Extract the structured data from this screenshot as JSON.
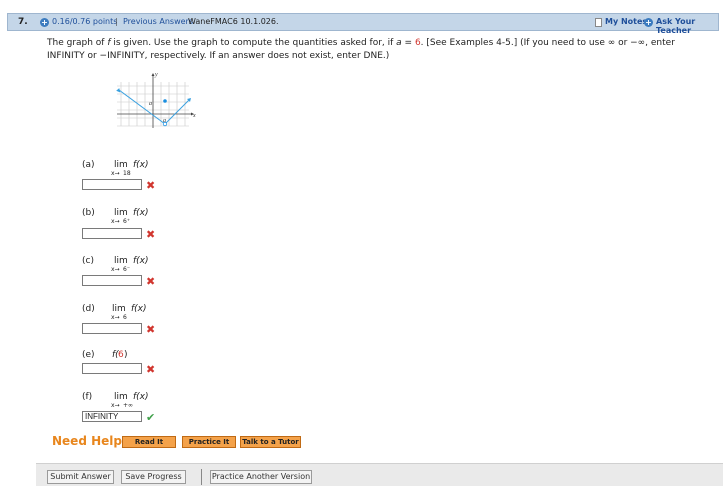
{
  "header": {
    "number": "7.",
    "points": "0.16/0.76 points",
    "separator": "|",
    "previous_answers": "Previous Answers",
    "problem_id": "WaneFMAC6 10.1.026.",
    "my_notes": "My Notes",
    "ask_teacher": "Ask Your Teacher"
  },
  "prompt": {
    "part1": "The graph of ",
    "f": "f",
    "part2": " is given. Use the graph to compute the quantities asked for, if ",
    "a": "a",
    "eq": " = ",
    "aval": "6",
    "part3": ". [See Examples 4-5.] (If you need to use ∞ or −∞, enter INFINITY or −INFINITY, respectively. If an answer does not exist, enter DNE.)"
  },
  "graph": {
    "x_axis_label": "x",
    "y_axis_label": "y",
    "a_label_y": "a",
    "a_label_x": "a",
    "line_color": "#3aa1e0",
    "dot_color": "#1a8fe0"
  },
  "parts": [
    {
      "label": "(a)",
      "lim": "lim",
      "func": "f(x)",
      "sub_var": "x→",
      "sub_to": "18",
      "sub_to_red": true,
      "value": "",
      "status": "wrong"
    },
    {
      "label": "(b)",
      "lim": "lim",
      "func": "f(x)",
      "sub_var": "x→",
      "sub_to": "6⁺",
      "sub_to_red": true,
      "value": "",
      "status": "wrong"
    },
    {
      "label": "(c)",
      "lim": "lim",
      "func": "f(x)",
      "sub_var": "x→",
      "sub_to": "6⁻",
      "sub_to_red": true,
      "value": "",
      "status": "wrong"
    },
    {
      "label": "(d)",
      "lim": "lim",
      "func": "f(x)",
      "sub_var": "x→",
      "sub_to": "6",
      "sub_to_red": true,
      "value": "",
      "status": "wrong"
    },
    {
      "label": "(e)",
      "func_pre": "f(",
      "func_arg": "6",
      "func_post": ")",
      "value": "",
      "status": "wrong"
    },
    {
      "label": "(f)",
      "lim": "lim",
      "func": "f(x)",
      "sub_var": "x→",
      "sub_to": "+∞",
      "sub_to_red": false,
      "value": "INFINITY",
      "status": "correct"
    }
  ],
  "icons": {
    "wrong": "✖",
    "correct": "✔"
  },
  "help": {
    "title": "Need Help?",
    "read": "Read It",
    "practice": "Practice It",
    "tutor": "Talk to a Tutor"
  },
  "footer": {
    "submit": "Submit Answer",
    "save": "Save Progress",
    "practice_another": "Practice Another Version"
  }
}
